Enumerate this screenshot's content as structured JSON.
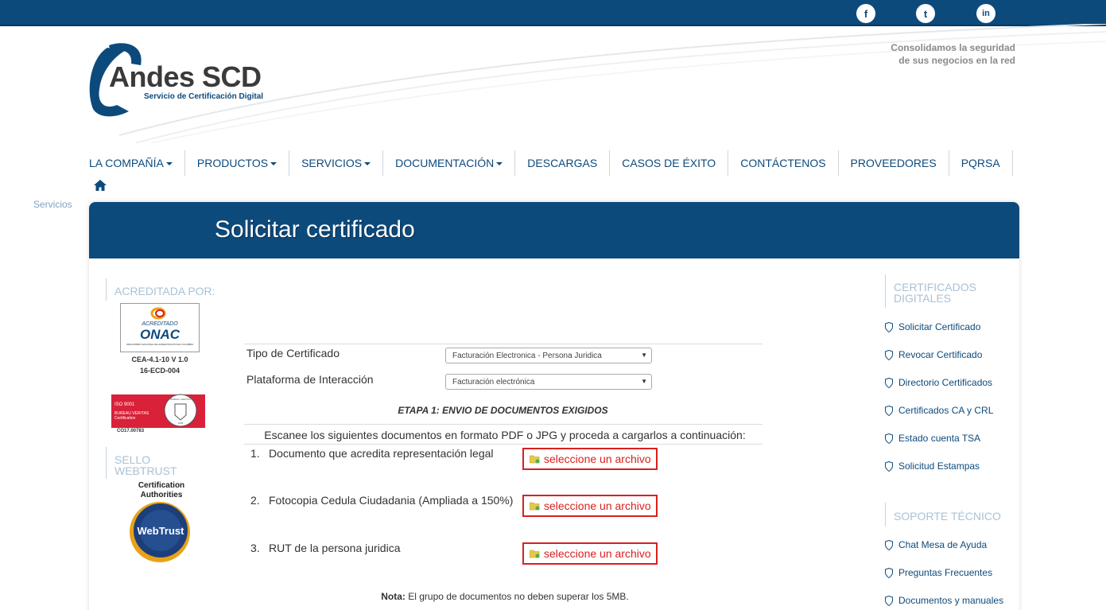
{
  "social": [
    {
      "label": "f",
      "icon": "facebook-icon"
    },
    {
      "label": "t",
      "icon": "twitter-icon"
    },
    {
      "label": "in",
      "icon": "linkedin-icon"
    }
  ],
  "brand": {
    "name": "Andes SCD",
    "subtitle": "Servicio de Certificación Digital",
    "tagline_1": "Consolidamos la seguridad",
    "tagline_2": "de sus negocios en la red",
    "primary_color": "#0d4a7c",
    "alert_color": "#d9201f"
  },
  "nav": [
    {
      "label": "LA COMPAÑÍA",
      "dropdown": true
    },
    {
      "label": "PRODUCTOS",
      "dropdown": true
    },
    {
      "label": "SERVICIOS",
      "dropdown": true
    },
    {
      "label": "DOCUMENTACIÓN",
      "dropdown": true
    },
    {
      "label": "DESCARGAS",
      "dropdown": false
    },
    {
      "label": "CASOS DE ÉXITO",
      "dropdown": false
    },
    {
      "label": "CONTÁCTENOS",
      "dropdown": false
    },
    {
      "label": "PROVEEDORES",
      "dropdown": false
    },
    {
      "label": "PQRSA",
      "dropdown": false
    }
  ],
  "breadcrumb": "Servicios",
  "page_title": "Solicitar certificado",
  "left_sidebar": {
    "accredited_heading": "ACREDITADA POR:",
    "onac_top": "ACREDITADO",
    "onac_name": "ONAC",
    "onac_sub": "ORGANISMO NACIONAL DE ACREDITACIÓN DE COLOMBIA",
    "cert_code_1": "CEA-4.1-10 V 1.0",
    "cert_code_2": "16-ECD-004",
    "iso_line_1": "ISO 9001",
    "iso_line_2": "BUREAU VERITAS",
    "iso_line_3": "Certification",
    "iso_seal_text": "BUREAU VERITAS",
    "iso_year": "1828",
    "iso_code": "CO17.00783",
    "webtrust_heading_1": "SELLO",
    "webtrust_heading_2": "WEBTRUST",
    "webtrust_label_1": "Certification",
    "webtrust_label_2": "Authorities",
    "webtrust_seal": "WebTrust"
  },
  "form": {
    "tipo_label": "Tipo de Certificado",
    "tipo_value": "Facturación Electronica - Persona Juridica",
    "plataforma_label": "Plataforma de Interacción",
    "plataforma_value": "Facturación electrónica",
    "etapa": "ETAPA 1: ENVIO DE DOCUMENTOS EXIGIDOS",
    "instructions": "Escanee los siguientes documentos en formato PDF o JPG y proceda a cargarlos a continuación:",
    "documents": [
      {
        "num": "1.",
        "label": "Documento que acredita representación legal",
        "button": "seleccione un archivo"
      },
      {
        "num": "2.",
        "label": "Fotocopia Cedula Ciudadania (Ampliada a 150%)",
        "button": "seleccione un archivo"
      },
      {
        "num": "3.",
        "label": "RUT de la persona juridica",
        "button": "seleccione un archivo"
      }
    ],
    "nota_label": "Nota:",
    "nota_text": " El grupo de documentos no deben superar los 5MB."
  },
  "right_sidebar": {
    "certificados_heading_1": "CERTIFICADOS",
    "certificados_heading_2": "DIGITALES",
    "certificados_links": [
      "Solicitar Certificado",
      "Revocar Certificado",
      "Directorio Certificados",
      "Certificados CA y CRL",
      "Estado cuenta TSA",
      "Solicitud Estampas"
    ],
    "soporte_heading": "SOPORTE TÉCNICO",
    "soporte_links": [
      "Chat Mesa de Ayuda",
      "Preguntas Frecuentes",
      "Documentos y manuales"
    ]
  }
}
